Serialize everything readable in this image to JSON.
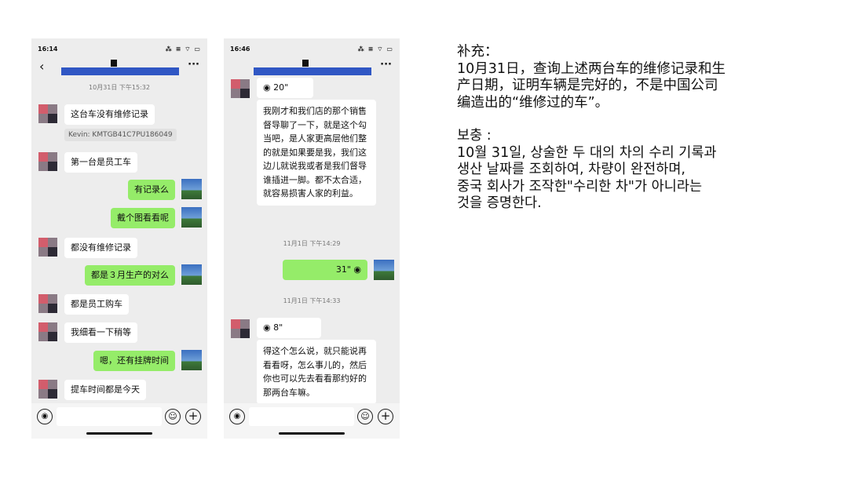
{
  "phone1": {
    "status_time": "16:14",
    "status_icons": "⁂ ≡ ⌔ ▭",
    "back": "‹",
    "more": "···",
    "date_time": "10月31日 下午15:32",
    "messages": [
      {
        "side": "left",
        "text": "这台车没有维修记录"
      },
      {
        "side": "quote",
        "text": "Kevin: KMTGB41C7PU186049"
      },
      {
        "side": "left",
        "text": "第一台是员工车"
      },
      {
        "side": "right",
        "text": "有记录么"
      },
      {
        "side": "right",
        "text": "戴个图看看呢"
      },
      {
        "side": "left",
        "text": "都没有维修记录"
      },
      {
        "side": "right",
        "text": "都是３月生产的对么"
      },
      {
        "side": "left",
        "text": "都是员工购车"
      },
      {
        "side": "left",
        "text": "我细看一下稍等"
      },
      {
        "side": "right",
        "text": "嗯，还有挂牌时间"
      },
      {
        "side": "left",
        "text": "提车时间都是今天"
      }
    ]
  },
  "phone2": {
    "status_time": "16:46",
    "status_icons": "⁂ ≡ ⌔ ▭",
    "more": "···",
    "voice1": "20\"",
    "long_message": "我刚才和我们店的那个销售督导聊了一下，就是这个勾当吧，是人家更高层他们整的就是如果要是我，我们这边儿就说我或者是我们督导谁插进一脚。都不太合适，就容易损害人家的利益。",
    "date_time_1": "11月1日 下午14:29",
    "voice2": "31\"",
    "date_time_2": "11月1日 下午14:33",
    "voice3": "8\"",
    "last_message": "得这个怎么说，就只能说再看看呀，怎么事儿的，然后你也可以先去看看那约好的那两台车嘛。"
  },
  "input_bar": {
    "voice_icon": "◉",
    "emoji_icon": "☺",
    "plus_icon": "+"
  },
  "notes": {
    "zh_title": "补充：",
    "zh_line1": "10月31日，查询上述两台车的维修记录和生",
    "zh_line2": "产日期，证明车辆是完好的，不是中国公司",
    "zh_line3": "编造出的“维修过的车”。",
    "ko_title": "보충 :",
    "ko_line1": "10월 31일, 상술한 두 대의 차의 수리 기록과",
    "ko_line2": "생산 날짜를 조회하여, 차량이 완전하며,",
    "ko_line3": "중국 회사가 조작한\"수리한 차\"가 아니라는",
    "ko_line4": "것을 증명한다."
  }
}
